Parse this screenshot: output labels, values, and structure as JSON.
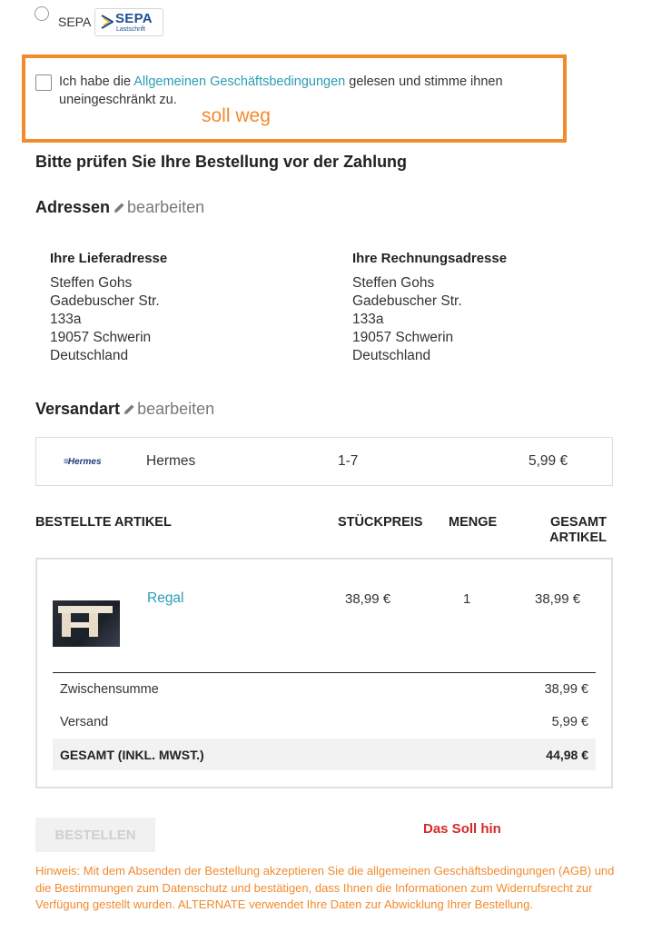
{
  "payment": {
    "sepa_label": "SEPA",
    "sepa_logo_text": "SEPA",
    "sepa_logo_sub": "Lastschrift"
  },
  "terms": {
    "prefix": "Ich habe die ",
    "link": "Allgemeinen Geschäftsbedingungen",
    "suffix": " gelesen und stimme ihnen uneingeschränkt zu."
  },
  "annotations": {
    "remove_note": "soll weg",
    "move_note": "Das Soll hin",
    "notice": "Hinweis: Mit dem Absenden der Bestellung akzeptieren Sie die allgemeinen Geschäftsbedingungen (AGB) und die Bestimmungen zum Datenschutz und bestätigen, dass Ihnen die Informationen zum Widerrufsrecht zur Verfügung gestellt wurden. ALTERNATE verwendet Ihre Daten zur Abwicklung Ihrer Bestellung."
  },
  "review_title": "Bitte prüfen Sie Ihre Bestellung vor der Zahlung",
  "addresses": {
    "title": "Adressen",
    "edit_label": "bearbeiten",
    "delivery": {
      "title": "Ihre Lieferadresse",
      "lines": [
        "Steffen Gohs",
        "Gadebuscher Str.",
        "133a",
        "19057 Schwerin",
        "Deutschland"
      ]
    },
    "billing": {
      "title": "Ihre Rechnungsadresse",
      "lines": [
        "Steffen Gohs",
        "Gadebuscher Str.",
        "133a",
        "19057 Schwerin",
        "Deutschland"
      ]
    }
  },
  "shipping": {
    "title": "Versandart",
    "edit_label": "bearbeiten",
    "logo_text": "Hermes",
    "carrier": "Hermes",
    "days": "1-7",
    "price": "5,99 €"
  },
  "items_table": {
    "headers": {
      "article": "BESTELLTE ARTIKEL",
      "unit_price": "STÜCKPREIS",
      "quantity": "MENGE",
      "total_line1": "GESAMT",
      "total_line2": "ARTIKEL"
    },
    "rows": [
      {
        "name": "Regal",
        "unit_price": "38,99 €",
        "quantity": "1",
        "total": "38,99 €"
      }
    ]
  },
  "summary": {
    "subtotal_label": "Zwischensumme",
    "subtotal_value": "38,99 €",
    "shipping_label": "Versand",
    "shipping_value": "5,99 €",
    "total_label": "GESAMT (INKL. MWST.)",
    "total_value": "44,98 €"
  },
  "order_button": "BESTELLEN",
  "colors": {
    "accent_link": "#2b9cb6",
    "annotation_orange": "#f28a2e",
    "annotation_red": "#d42a2a"
  }
}
